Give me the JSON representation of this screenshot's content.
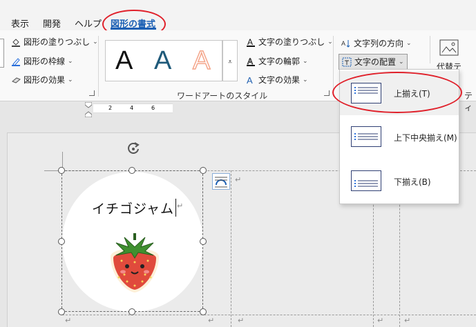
{
  "tabs": [
    {
      "label": "表示"
    },
    {
      "label": "開発"
    },
    {
      "label": "ヘルプ"
    },
    {
      "label": "図形の書式",
      "active": true
    }
  ],
  "ribbon": {
    "shape_styles": {
      "fill": "図形の塗りつぶし",
      "outline": "図形の枠線",
      "effects": "図形の効果"
    },
    "wordart": {
      "group_label": "ワードアートのスタイル",
      "letters": [
        "A",
        "A",
        "A"
      ],
      "letter_colors": [
        "#111111",
        "#1f5a7a",
        "#f4a58a"
      ],
      "text_fill": "文字の塗りつぶし",
      "text_outline": "文字の輪郭",
      "text_effects": "文字の効果"
    },
    "text": {
      "direction": "文字列の方向",
      "align": "文字の配置"
    },
    "alt_text": "代替テ",
    "cut_label": "ティ"
  },
  "ruler": {
    "ticks": [
      "2",
      "4",
      "6"
    ]
  },
  "document": {
    "shape_text": "イチゴジャム",
    "return_mark": "↵"
  },
  "align_dropdown": {
    "items": [
      {
        "label": "上揃え(T)",
        "selected": true
      },
      {
        "label": "上下中央揃え(M)"
      },
      {
        "label": "下揃え(B)"
      }
    ]
  },
  "colors": {
    "accent": "#1a5fb4",
    "highlight_ring": "#e0202a"
  }
}
